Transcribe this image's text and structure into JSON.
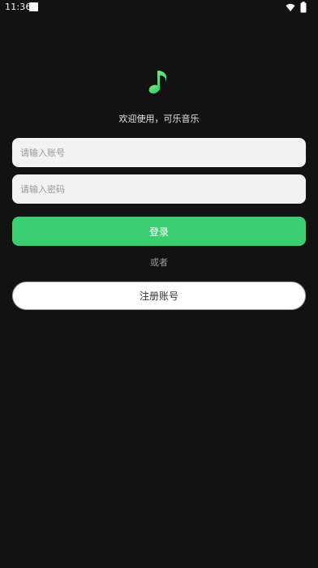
{
  "status_bar": {
    "time": "11:36"
  },
  "colors": {
    "background": "#121212",
    "accent": "#3ccd73",
    "input_background": "#f2f2f2",
    "register_background": "#ffffff"
  },
  "logo": {
    "icon": "music-note-icon"
  },
  "welcome_text": "欢迎使用，可乐音乐",
  "form": {
    "account_placeholder": "请输入账号",
    "password_placeholder": "请输入密码",
    "login_label": "登录",
    "or_label": "或者",
    "register_label": "注册账号"
  }
}
